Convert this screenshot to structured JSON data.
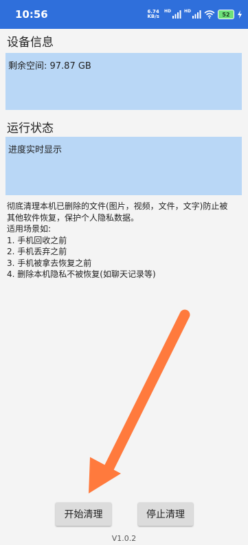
{
  "status_bar": {
    "time": "10:56",
    "net_speed_value": "6.74",
    "net_speed_unit": "KB/s",
    "hd_label_1": "HD",
    "hd_label_2": "HD",
    "battery_level": "52",
    "color": "#2f6fdb"
  },
  "device_info": {
    "title": "设备信息",
    "text": "剩余空间: 97.87 GB"
  },
  "run_status": {
    "title": "运行状态",
    "text": "进度实时显示"
  },
  "description": {
    "lines": [
      "彻底清理本机已删除的文件(图片，视频，文件，文字)防止被",
      "其他软件恢复，保护个人隐私数据。",
      "适用场景如:",
      "1. 手机回收之前",
      "2. 手机丢弃之前",
      "3. 手机被拿去恢复之前",
      "4. 删除本机隐私不被恢复(如聊天记录等)"
    ]
  },
  "buttons": {
    "start_label": "开始清理",
    "stop_label": "停止清理"
  },
  "version": "V1.0.2",
  "colors": {
    "accent": "#2f6fdb",
    "box_bg": "#b9d7f6",
    "arrow": "#ff7a3d",
    "button_bg": "#dcdcdc"
  },
  "icons": [
    "signal-icon",
    "wifi-icon",
    "battery-icon",
    "charging-icon",
    "arrow-annotation"
  ]
}
